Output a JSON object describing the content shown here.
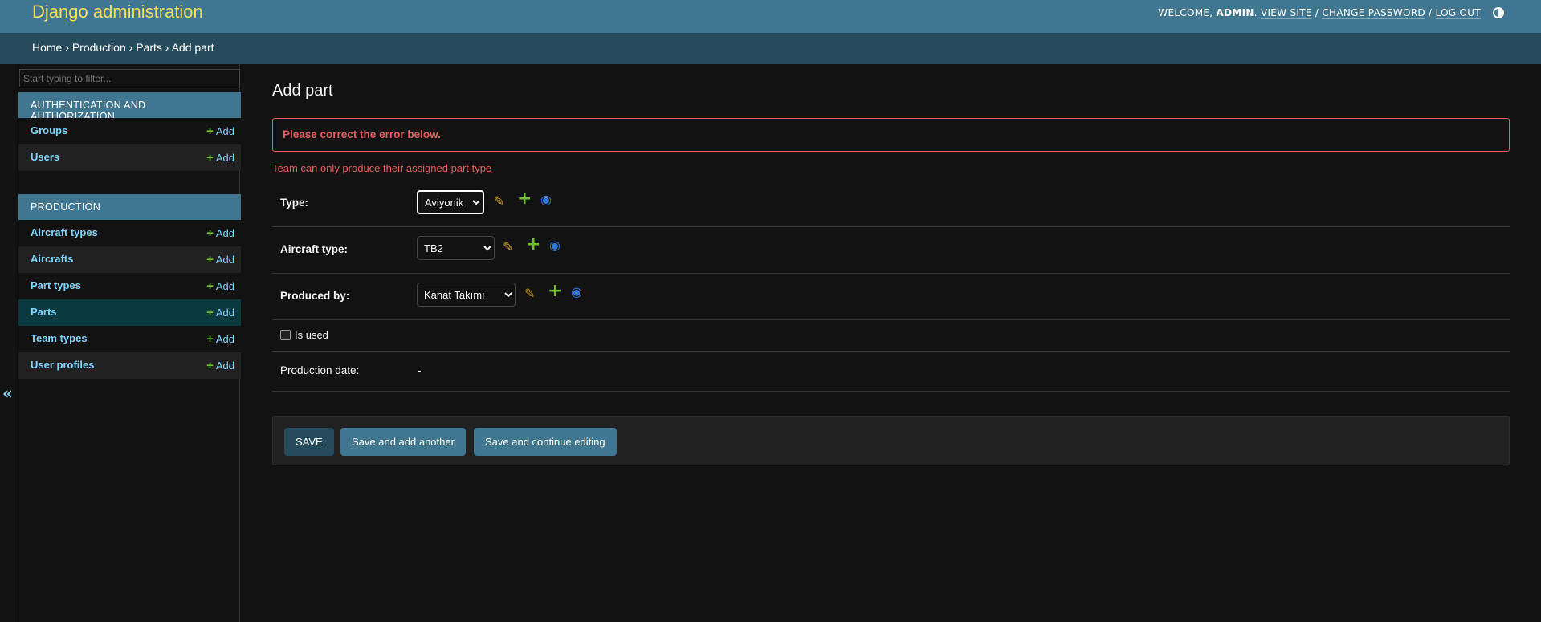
{
  "header": {
    "brand": "Django administration",
    "welcome": "WELCOME,",
    "user": "ADMIN",
    "view_site": "VIEW SITE",
    "change_password": "CHANGE PASSWORD",
    "log_out": "LOG OUT",
    "sep": "/"
  },
  "breadcrumbs": {
    "home": "Home",
    "production": "Production",
    "parts": "Parts",
    "current": "Add part",
    "sep": "›"
  },
  "sidebar": {
    "filter_placeholder": "Start typing to filter...",
    "add_label": "Add",
    "modules": [
      {
        "caption": "AUTHENTICATION AND AUTHORIZATION",
        "items": [
          {
            "label": "Groups"
          },
          {
            "label": "Users"
          }
        ]
      },
      {
        "caption": "PRODUCTION",
        "items": [
          {
            "label": "Aircraft types"
          },
          {
            "label": "Aircrafts"
          },
          {
            "label": "Part types"
          },
          {
            "label": "Parts",
            "current": true
          },
          {
            "label": "Team types"
          },
          {
            "label": "User profiles"
          }
        ]
      }
    ],
    "collapse_glyph": "«"
  },
  "form": {
    "title": "Add part",
    "errornote": "Please correct the error below.",
    "error": "Team can only produce their assigned part type",
    "fields": {
      "type": {
        "label": "Type:",
        "value": "Aviyonik"
      },
      "aircraft_type": {
        "label": "Aircraft type:",
        "value": "TB2"
      },
      "produced_by": {
        "label": "Produced by:",
        "value": "Kanat Takımı"
      },
      "is_used": {
        "label": "Is used",
        "checked": false
      },
      "production_date": {
        "label": "Production date:",
        "value": "-"
      }
    },
    "buttons": {
      "save": "SAVE",
      "save_add_another": "Save and add another",
      "save_continue": "Save and continue editing"
    }
  },
  "colors": {
    "header_bg": "#417690",
    "breadcrumb_bg": "#264b5d",
    "brand": "#f5dd5d",
    "link": "#81d4fa",
    "error": "#e35f5f",
    "add_green": "#70bf2b"
  }
}
